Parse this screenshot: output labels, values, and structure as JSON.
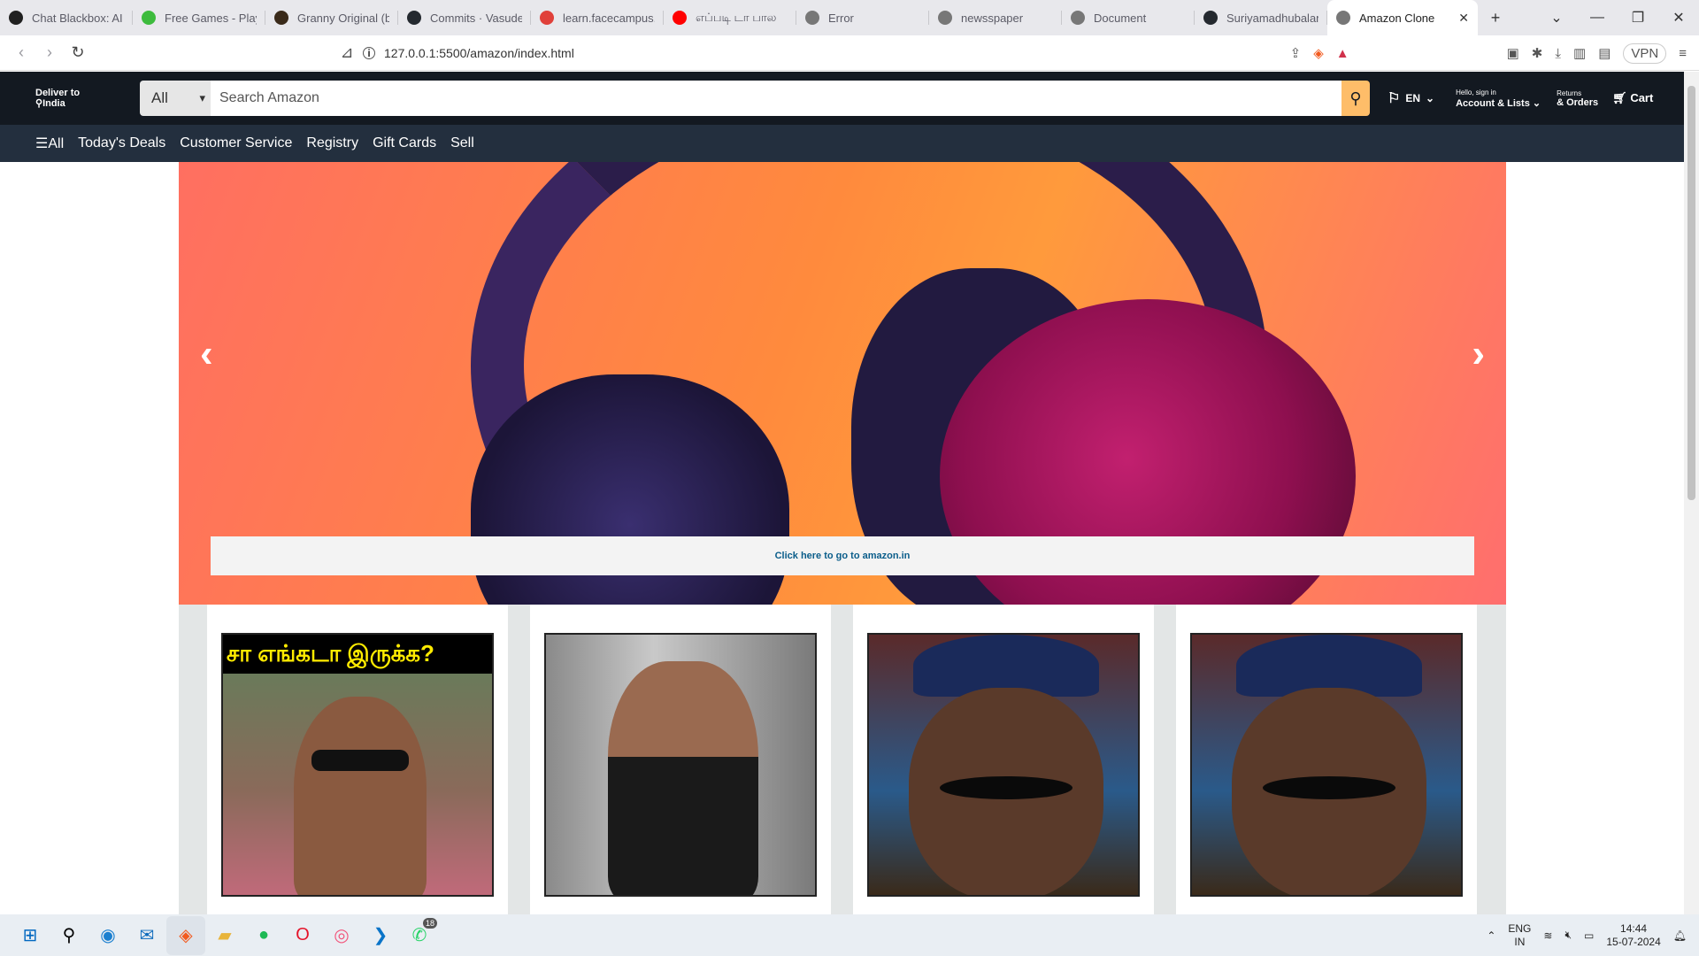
{
  "browser": {
    "tabs": [
      {
        "title": "Chat Blackbox: AI Co",
        "icon": "blackbox-icon",
        "color": "#202020"
      },
      {
        "title": "Free Games - Play G",
        "icon": "games-icon",
        "color": "#3dbb3d"
      },
      {
        "title": "Granny Original (by",
        "icon": "granny-icon",
        "color": "#3a2a1a"
      },
      {
        "title": "Commits · Vasudeva",
        "icon": "github-icon",
        "color": "#24292f"
      },
      {
        "title": "learn.facecampus.or",
        "icon": "facecampus-icon",
        "color": "#e0403a"
      },
      {
        "title": "எப்படி டா பால",
        "icon": "youtube-icon",
        "color": "#ff0000"
      },
      {
        "title": "Error",
        "icon": "globe-icon",
        "color": "#777777"
      },
      {
        "title": "newsspaper",
        "icon": "globe-icon",
        "color": "#777777"
      },
      {
        "title": "Document",
        "icon": "globe-icon",
        "color": "#777777"
      },
      {
        "title": "Suriyamadhubalan",
        "icon": "github-icon",
        "color": "#24292f"
      },
      {
        "title": "Amazon Clone",
        "icon": "globe-icon",
        "color": "#777777",
        "active": true
      }
    ],
    "url": "127.0.0.1:5500/amazon/index.html",
    "vpn_label": "VPN"
  },
  "amazon": {
    "deliver_line1": "Deliver to",
    "deliver_line2": "India",
    "search_category": "All",
    "search_placeholder": "Search Amazon",
    "language": "EN",
    "account_small": "Hello, sign in",
    "account_big": "Account & Lists",
    "returns_small": "Returns",
    "returns_big": "& Orders",
    "cart": "Cart",
    "nav_items": [
      "All",
      "Today's Deals",
      "Customer Service",
      "Registry",
      "Gift Cards",
      "Sell"
    ],
    "promo_text": "Click here to go to amazon.in"
  },
  "cards": [
    {
      "caption": "சா எங்கடா இருக்க?"
    },
    {
      "caption": ""
    },
    {
      "caption": ""
    },
    {
      "caption": ""
    }
  ],
  "taskbar": {
    "language_line1": "ENG",
    "language_line2": "IN",
    "time": "14:44",
    "date": "15-07-2024",
    "whatsapp_badge": "18"
  }
}
